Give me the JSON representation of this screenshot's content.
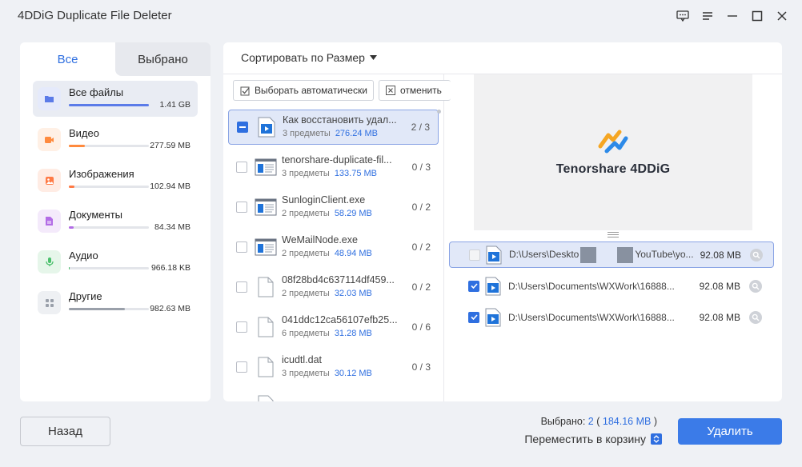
{
  "app": {
    "title": "4DDiG Duplicate File Deleter"
  },
  "window_icons": [
    "feedback-icon",
    "menu-icon",
    "minimize-icon",
    "maximize-icon",
    "close-icon"
  ],
  "tabs": {
    "all": "Все",
    "selected": "Выбрано"
  },
  "categories": [
    {
      "name": "Все файлы",
      "size": "1.41 GB",
      "fill": 1.0,
      "color": "#5b7be8",
      "icon": "folder-icon",
      "bg": "#e5eafb",
      "active": true
    },
    {
      "name": "Видео",
      "size": "277.59 MB",
      "fill": 0.2,
      "color": "#ff8a3d",
      "icon": "video-icon",
      "bg": "#fff0e5",
      "active": false
    },
    {
      "name": "Изображения",
      "size": "102.94 MB",
      "fill": 0.07,
      "color": "#ff7a45",
      "icon": "image-icon",
      "bg": "#ffece4",
      "active": false
    },
    {
      "name": "Документы",
      "size": "84.34 MB",
      "fill": 0.06,
      "color": "#b36ce6",
      "icon": "document-icon",
      "bg": "#f4eafb",
      "active": false
    },
    {
      "name": "Аудио",
      "size": "966.18 KB",
      "fill": 0.01,
      "color": "#4ac06c",
      "icon": "audio-icon",
      "bg": "#e6f6ea",
      "active": false
    },
    {
      "name": "Другие",
      "size": "982.63 MB",
      "fill": 0.7,
      "color": "#9aa0aa",
      "icon": "other-icon",
      "bg": "#eef0f3",
      "active": false
    }
  ],
  "toolbar": {
    "sort_label": "Сортировать по Размер",
    "auto_select": "Выборать автоматически",
    "cancel": "отменить"
  },
  "files": [
    {
      "name": "Как восстановить удал...",
      "count": "3 предметы",
      "size": "276.24 MB",
      "ratio": "2 / 3",
      "type": "video",
      "state": "partial",
      "selected": true
    },
    {
      "name": "tenorshare-duplicate-fil...",
      "count": "3 предметы",
      "size": "133.75 MB",
      "ratio": "0 / 3",
      "type": "exe",
      "state": "none",
      "selected": false
    },
    {
      "name": "SunloginClient.exe",
      "count": "2 предметы",
      "size": "58.29 MB",
      "ratio": "0 / 2",
      "type": "exe",
      "state": "none",
      "selected": false
    },
    {
      "name": "WeMailNode.exe",
      "count": "2 предметы",
      "size": "48.94 MB",
      "ratio": "0 / 2",
      "type": "exe",
      "state": "none",
      "selected": false
    },
    {
      "name": "08f28bd4c637114df459...",
      "count": "2 предметы",
      "size": "32.03 MB",
      "ratio": "0 / 2",
      "type": "blank",
      "state": "none",
      "selected": false
    },
    {
      "name": "041ddc12ca56107efb25...",
      "count": "6 предметы",
      "size": "31.28 MB",
      "ratio": "0 / 6",
      "type": "blank",
      "state": "none",
      "selected": false
    },
    {
      "name": "icudtl.dat",
      "count": "3 предметы",
      "size": "30.12 MB",
      "ratio": "0 / 3",
      "type": "blank",
      "state": "none",
      "selected": false
    }
  ],
  "preview": {
    "brand": "Tenorshare 4DDiG"
  },
  "duplicates": [
    {
      "path_a": "D:\\Users\\Deskto",
      "path_b": "YouTube\\yo...",
      "redacted": true,
      "size": "92.08 MB",
      "state": "disabled",
      "selected": true
    },
    {
      "path_a": "D:\\Users\\Documents\\WXWork\\16888...",
      "path_b": "",
      "redacted": false,
      "size": "92.08 MB",
      "state": "checked",
      "selected": false
    },
    {
      "path_a": "D:\\Users\\Documents\\WXWork\\16888...",
      "path_b": "",
      "redacted": false,
      "size": "92.08 MB",
      "state": "checked",
      "selected": false
    }
  ],
  "footer": {
    "back": "Назад",
    "selected_label": "Выбрано:",
    "selected_count": "2",
    "selected_size": "184.16 MB",
    "move_to_trash": "Переместить в корзину",
    "delete": "Удалить"
  }
}
